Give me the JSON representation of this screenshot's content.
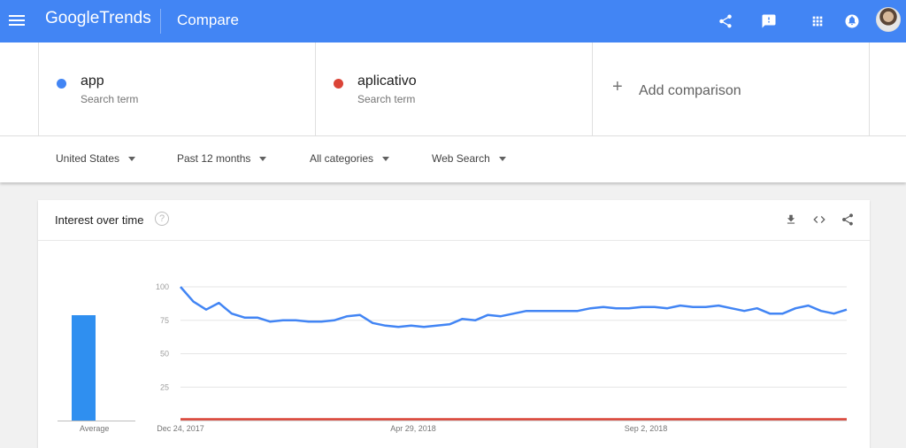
{
  "header": {
    "logo_google": "Google",
    "logo_trends": "Trends",
    "title": "Compare",
    "icons": [
      "menu-icon",
      "share-icon",
      "feedback-icon",
      "apps-icon",
      "notifications-icon",
      "avatar"
    ],
    "color": "#4285f4"
  },
  "terms": [
    {
      "name": "app",
      "sub": "Search term",
      "color": "#4285f4"
    },
    {
      "name": "aplicativo",
      "sub": "Search term",
      "color": "#db4437"
    }
  ],
  "add_comparison": {
    "plus": "+",
    "label": "Add comparison"
  },
  "filters": {
    "region": "United States",
    "period": "Past 12 months",
    "category": "All categories",
    "search_type": "Web Search"
  },
  "card": {
    "title": "Interest over time",
    "help": "?",
    "icons": [
      "download-icon",
      "embed-icon",
      "share-icon"
    ]
  },
  "chart_data": {
    "type": "line",
    "xlabel": "",
    "ylabel": "",
    "ylim": [
      0,
      100
    ],
    "yticks": [
      "100",
      "75",
      "50",
      "25"
    ],
    "xticks": [
      "Dec 24, 2017",
      "Apr 29, 2018",
      "Sep 2, 2018"
    ],
    "grid": true,
    "series": [
      {
        "name": "app",
        "color": "#4285f4",
        "values": [
          100,
          89,
          83,
          88,
          80,
          77,
          77,
          74,
          75,
          75,
          74,
          74,
          75,
          78,
          79,
          73,
          71,
          70,
          71,
          70,
          71,
          72,
          76,
          75,
          79,
          78,
          80,
          82,
          82,
          82,
          82,
          82,
          84,
          85,
          84,
          84,
          85,
          85,
          84,
          86,
          85,
          85,
          86,
          84,
          82,
          84,
          80,
          80,
          84,
          86,
          82,
          80,
          83
        ]
      },
      {
        "name": "aplicativo",
        "color": "#db4437",
        "values": [
          1,
          1,
          1,
          1,
          1,
          1,
          1,
          1,
          1,
          1,
          1,
          1,
          1,
          1,
          1,
          1,
          1,
          1,
          1,
          1,
          1,
          1,
          1,
          1,
          1,
          1,
          1,
          1,
          1,
          1,
          1,
          1,
          1,
          1,
          1,
          1,
          1,
          1,
          1,
          1,
          1,
          1,
          1,
          1,
          1,
          1,
          1,
          1,
          1,
          1,
          1,
          1,
          1
        ]
      }
    ],
    "average": {
      "label": "Average",
      "value": 79,
      "color": "#2f8ff0"
    }
  }
}
